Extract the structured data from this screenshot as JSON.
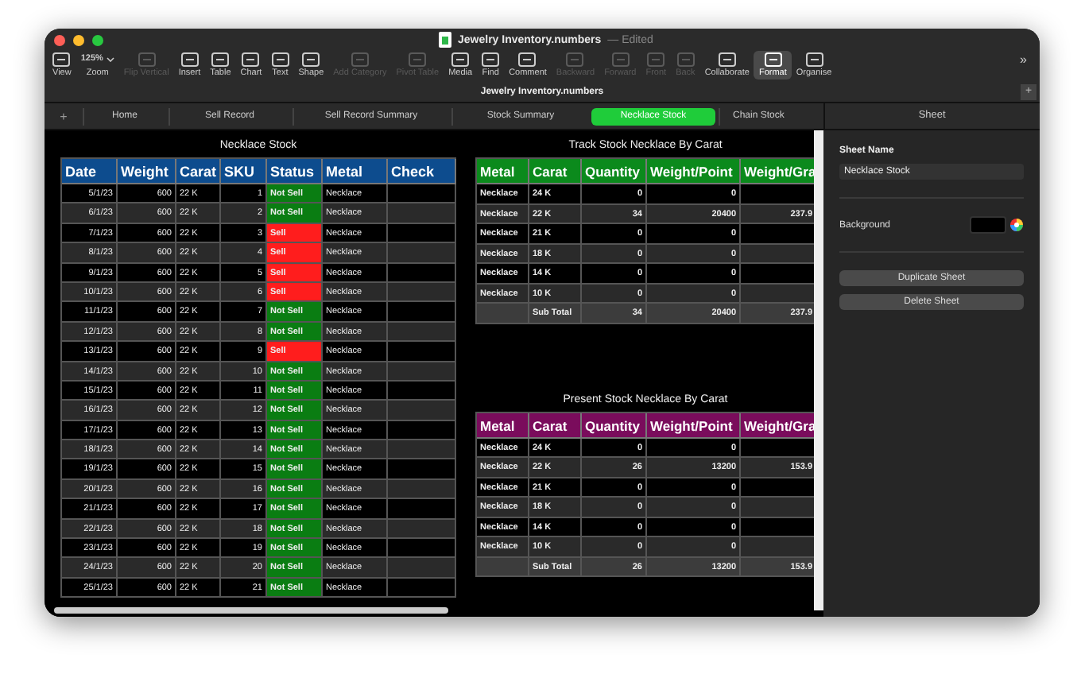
{
  "window": {
    "title": "Jewelry Inventory.numbers",
    "edited": "— Edited",
    "document_title": "Jewelry Inventory.numbers"
  },
  "toolbar": [
    {
      "kind": "button",
      "label": "View",
      "disabled": false,
      "selected": false
    },
    {
      "kind": "zoom",
      "label": "Zoom",
      "value": "125%"
    },
    {
      "kind": "button",
      "label": "Flip Vertical",
      "disabled": true,
      "selected": false
    },
    {
      "kind": "button",
      "label": "Insert",
      "disabled": false,
      "selected": false
    },
    {
      "kind": "button",
      "label": "Table",
      "disabled": false,
      "selected": false
    },
    {
      "kind": "button",
      "label": "Chart",
      "disabled": false,
      "selected": false
    },
    {
      "kind": "button",
      "label": "Text",
      "disabled": false,
      "selected": false
    },
    {
      "kind": "button",
      "label": "Shape",
      "disabled": false,
      "selected": false
    },
    {
      "kind": "button",
      "label": "Add Category",
      "disabled": true,
      "selected": false
    },
    {
      "kind": "button",
      "label": "Pivot Table",
      "disabled": true,
      "selected": false
    },
    {
      "kind": "button",
      "label": "Media",
      "disabled": false,
      "selected": false
    },
    {
      "kind": "button",
      "label": "Find",
      "disabled": false,
      "selected": false
    },
    {
      "kind": "button",
      "label": "Comment",
      "disabled": false,
      "selected": false
    },
    {
      "kind": "button",
      "label": "Backward",
      "disabled": true,
      "selected": false
    },
    {
      "kind": "button",
      "label": "Forward",
      "disabled": true,
      "selected": false
    },
    {
      "kind": "button",
      "label": "Front",
      "disabled": true,
      "selected": false
    },
    {
      "kind": "button",
      "label": "Back",
      "disabled": true,
      "selected": false
    },
    {
      "kind": "button",
      "label": "Collaborate",
      "disabled": false,
      "selected": false
    },
    {
      "kind": "button",
      "label": "Format",
      "disabled": false,
      "selected": true
    },
    {
      "kind": "button",
      "label": "Organise",
      "disabled": false,
      "selected": false
    }
  ],
  "toolbar_overflow": "»",
  "sheet_tabs": {
    "add": "+",
    "tabs": [
      {
        "label": "Home",
        "selected": false
      },
      {
        "label": "Sell Record",
        "selected": false
      },
      {
        "label": "Sell Record Summary",
        "selected": false
      },
      {
        "label": "Stock Summary",
        "selected": false
      },
      {
        "label": "Necklace Stock",
        "selected": true
      },
      {
        "label": "Chain Stock",
        "selected": false
      }
    ]
  },
  "stock_table": {
    "title": "Necklace Stock",
    "columns": [
      "Date",
      "Weight",
      "Carat",
      "SKU",
      "Status",
      "Metal",
      "Check"
    ],
    "rows": [
      {
        "date": "5/1/23",
        "weight": "600",
        "carat": "22 K",
        "sku": "1",
        "status": "Not Sell",
        "sold": false,
        "metal": "Necklace"
      },
      {
        "date": "6/1/23",
        "weight": "600",
        "carat": "22 K",
        "sku": "2",
        "status": "Not Sell",
        "sold": false,
        "metal": "Necklace"
      },
      {
        "date": "7/1/23",
        "weight": "600",
        "carat": "22 K",
        "sku": "3",
        "status": "Sell",
        "sold": true,
        "metal": "Necklace"
      },
      {
        "date": "8/1/23",
        "weight": "600",
        "carat": "22 K",
        "sku": "4",
        "status": "Sell",
        "sold": true,
        "metal": "Necklace"
      },
      {
        "date": "9/1/23",
        "weight": "600",
        "carat": "22 K",
        "sku": "5",
        "status": "Sell",
        "sold": true,
        "metal": "Necklace"
      },
      {
        "date": "10/1/23",
        "weight": "600",
        "carat": "22 K",
        "sku": "6",
        "status": "Sell",
        "sold": true,
        "metal": "Necklace"
      },
      {
        "date": "11/1/23",
        "weight": "600",
        "carat": "22 K",
        "sku": "7",
        "status": "Not Sell",
        "sold": false,
        "metal": "Necklace"
      },
      {
        "date": "12/1/23",
        "weight": "600",
        "carat": "22 K",
        "sku": "8",
        "status": "Not Sell",
        "sold": false,
        "metal": "Necklace"
      },
      {
        "date": "13/1/23",
        "weight": "600",
        "carat": "22 K",
        "sku": "9",
        "status": "Sell",
        "sold": true,
        "metal": "Necklace"
      },
      {
        "date": "14/1/23",
        "weight": "600",
        "carat": "22 K",
        "sku": "10",
        "status": "Not Sell",
        "sold": false,
        "metal": "Necklace"
      },
      {
        "date": "15/1/23",
        "weight": "600",
        "carat": "22 K",
        "sku": "11",
        "status": "Not Sell",
        "sold": false,
        "metal": "Necklace"
      },
      {
        "date": "16/1/23",
        "weight": "600",
        "carat": "22 K",
        "sku": "12",
        "status": "Not Sell",
        "sold": false,
        "metal": "Necklace"
      },
      {
        "date": "17/1/23",
        "weight": "600",
        "carat": "22 K",
        "sku": "13",
        "status": "Not Sell",
        "sold": false,
        "metal": "Necklace"
      },
      {
        "date": "18/1/23",
        "weight": "600",
        "carat": "22 K",
        "sku": "14",
        "status": "Not Sell",
        "sold": false,
        "metal": "Necklace"
      },
      {
        "date": "19/1/23",
        "weight": "600",
        "carat": "22 K",
        "sku": "15",
        "status": "Not Sell",
        "sold": false,
        "metal": "Necklace"
      },
      {
        "date": "20/1/23",
        "weight": "600",
        "carat": "22 K",
        "sku": "16",
        "status": "Not Sell",
        "sold": false,
        "metal": "Necklace"
      },
      {
        "date": "21/1/23",
        "weight": "600",
        "carat": "22 K",
        "sku": "17",
        "status": "Not Sell",
        "sold": false,
        "metal": "Necklace"
      },
      {
        "date": "22/1/23",
        "weight": "600",
        "carat": "22 K",
        "sku": "18",
        "status": "Not Sell",
        "sold": false,
        "metal": "Necklace"
      },
      {
        "date": "23/1/23",
        "weight": "600",
        "carat": "22 K",
        "sku": "19",
        "status": "Not Sell",
        "sold": false,
        "metal": "Necklace"
      },
      {
        "date": "24/1/23",
        "weight": "600",
        "carat": "22 K",
        "sku": "20",
        "status": "Not Sell",
        "sold": false,
        "metal": "Necklace"
      },
      {
        "date": "25/1/23",
        "weight": "600",
        "carat": "22 K",
        "sku": "21",
        "status": "Not Sell",
        "sold": false,
        "metal": "Necklace"
      }
    ]
  },
  "summary_tables": [
    {
      "title": "Track Stock Necklace By Carat",
      "color": "#0b8a1c",
      "columns": [
        "Metal",
        "Carat",
        "Quantity",
        "Weight/Point",
        "Weight/Gra"
      ],
      "rows": [
        [
          "Necklace",
          "24 K",
          "0",
          "0"
        ],
        [
          "Necklace",
          "22 K",
          "34",
          "20400",
          "237.9"
        ],
        [
          "Necklace",
          "21 K",
          "0",
          "0"
        ],
        [
          "Necklace",
          "18 K",
          "0",
          "0"
        ],
        [
          "Necklace",
          "14 K",
          "0",
          "0"
        ],
        [
          "Necklace",
          "10 K",
          "0",
          "0"
        ]
      ],
      "total": [
        "Sub Total",
        "34",
        "20400",
        "237.9"
      ]
    },
    {
      "title": "Present Stock Necklace By Carat",
      "color": "#7a0c5c",
      "columns": [
        "Metal",
        "Carat",
        "Quantity",
        "Weight/Point",
        "Weight/Gra"
      ],
      "rows": [
        [
          "Necklace",
          "24 K",
          "0",
          "0"
        ],
        [
          "Necklace",
          "22 K",
          "26",
          "13200",
          "153.9"
        ],
        [
          "Necklace",
          "21 K",
          "0",
          "0"
        ],
        [
          "Necklace",
          "18 K",
          "0",
          "0"
        ],
        [
          "Necklace",
          "14 K",
          "0",
          "0"
        ],
        [
          "Necklace",
          "10 K",
          "0",
          "0"
        ]
      ],
      "total": [
        "Sub Total",
        "26",
        "13200",
        "153.9"
      ]
    }
  ],
  "sidebar": {
    "add": "+",
    "header": "Sheet",
    "name_label": "Sheet Name",
    "name_value": "Necklace Stock",
    "background_label": "Background",
    "buttons": [
      "Duplicate Sheet",
      "Delete Sheet"
    ]
  }
}
